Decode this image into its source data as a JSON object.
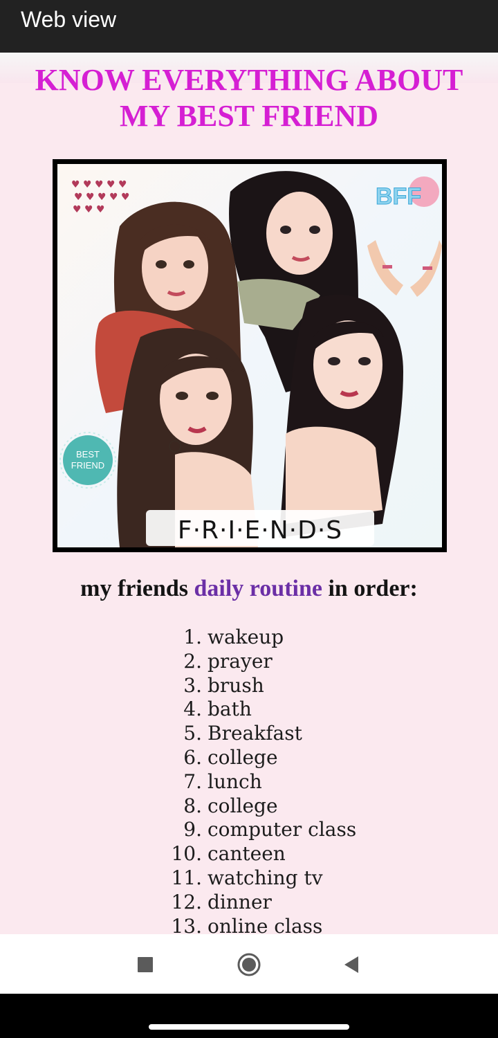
{
  "app_bar": {
    "title": "Web view"
  },
  "page": {
    "headline_line1": "KNOW EVERYTHING ABOUT",
    "headline_line2": "MY BEST FRIEND",
    "image": {
      "badge_top": "BFF",
      "badge_left_line1": "BEST",
      "badge_left_line2": "FRIEND",
      "caption": "F·R·I·E·N·D·S"
    },
    "subheading": {
      "prefix": "my friends",
      "accent": "daily routine",
      "suffix": "in order:"
    },
    "routine": [
      {
        "num": "1.",
        "text": "wakeup"
      },
      {
        "num": "2.",
        "text": "prayer"
      },
      {
        "num": "3.",
        "text": "brush"
      },
      {
        "num": "4.",
        "text": "bath"
      },
      {
        "num": "5.",
        "text": "Breakfast"
      },
      {
        "num": "6.",
        "text": "college"
      },
      {
        "num": "7.",
        "text": "lunch"
      },
      {
        "num": "8.",
        "text": "college"
      },
      {
        "num": "9.",
        "text": "computer class"
      },
      {
        "num": "10.",
        "text": "canteen"
      },
      {
        "num": "11.",
        "text": "watching tv"
      },
      {
        "num": "12.",
        "text": "dinner"
      },
      {
        "num": "13.",
        "text": "online class"
      }
    ]
  },
  "nav": {
    "recents_icon": "square-icon",
    "home_icon": "circle-icon",
    "back_icon": "triangle-left-icon"
  },
  "colors": {
    "headline": "#d51fd3",
    "accent": "#6b2fa6",
    "page_background": "#fbe9ef"
  }
}
